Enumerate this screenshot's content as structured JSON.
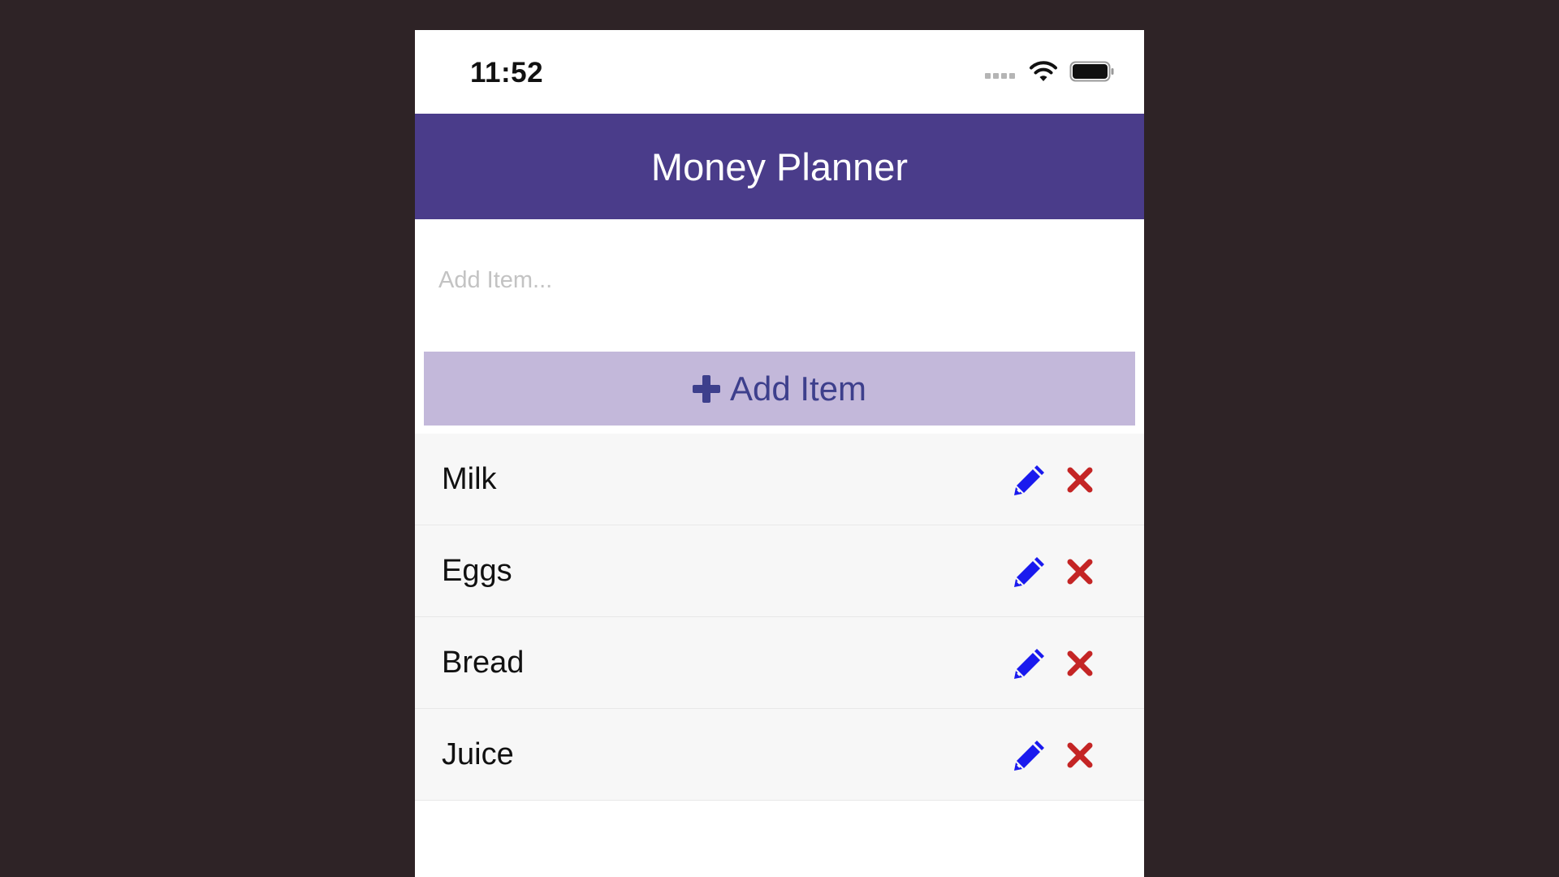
{
  "status_bar": {
    "time": "11:52"
  },
  "header": {
    "title": "Money Planner"
  },
  "add_form": {
    "input_placeholder": "Add Item...",
    "input_value": "",
    "button_label": "Add Item"
  },
  "items": [
    {
      "label": "Milk"
    },
    {
      "label": "Eggs"
    },
    {
      "label": "Bread"
    },
    {
      "label": "Juice"
    }
  ],
  "colors": {
    "header_bg": "#4a3c8a",
    "button_bg": "#c3b8da",
    "button_text": "#3d3f8c",
    "edit_icon": "#1a1aee",
    "delete_icon": "#c42525",
    "backdrop": "#2e2326"
  },
  "icons": {
    "add": "plus-icon",
    "edit": "pencil-icon",
    "delete": "close-icon"
  }
}
